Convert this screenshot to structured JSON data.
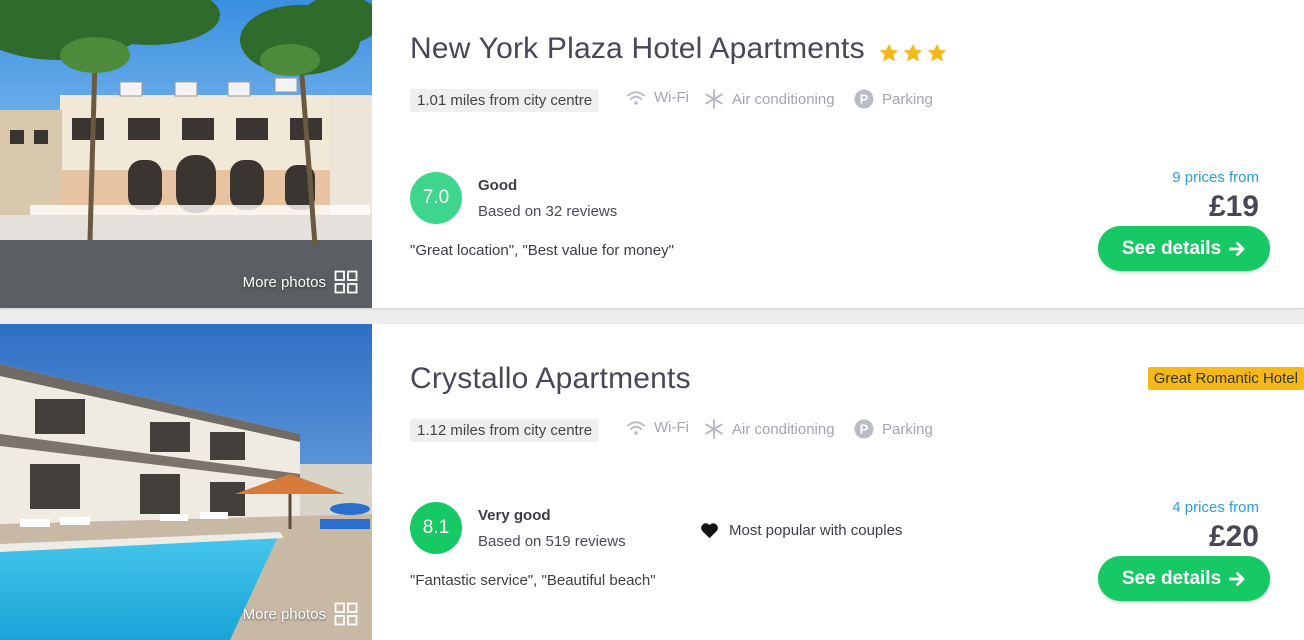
{
  "hotels": [
    {
      "name": "New York Plaza Hotel Apartments",
      "stars": 3,
      "tag": "",
      "distance": "1.01 miles from city centre",
      "amenities": [
        "Wi-Fi",
        "Air conditioning",
        "Parking"
      ],
      "score": "7.0",
      "score_color": "#3dd68c",
      "rating_word": "Good",
      "reviews": "Based on 32 reviews",
      "highlights": "\"Great location\", \"Best value for money\"",
      "popular_with": "",
      "prices_from": "9 prices from",
      "price": "£19",
      "button": "See details",
      "more_photos": "More photos"
    },
    {
      "name": "Crystallo Apartments",
      "stars": 0,
      "tag": "Great Romantic Hotel",
      "distance": "1.12 miles from city centre",
      "amenities": [
        "Wi-Fi",
        "Air conditioning",
        "Parking"
      ],
      "score": "8.1",
      "score_color": "#17c964",
      "rating_word": "Very good",
      "reviews": "Based on 519 reviews",
      "highlights": "\"Fantastic service\", \"Beautiful beach\"",
      "popular_with": "Most popular with couples",
      "prices_from": "4 prices from",
      "price": "£20",
      "button": "See details",
      "more_photos": "More photos"
    }
  ],
  "icons": {
    "wifi": "wifi-icon",
    "ac": "snowflake-icon",
    "parking": "parking-icon",
    "heart": "heart-icon",
    "star": "star-icon",
    "arrow": "arrow-right-icon",
    "grid": "grid-icon"
  },
  "colors": {
    "accent_green": "#17c964",
    "price_blue": "#2a9fd0",
    "star_yellow": "#f6b817"
  }
}
